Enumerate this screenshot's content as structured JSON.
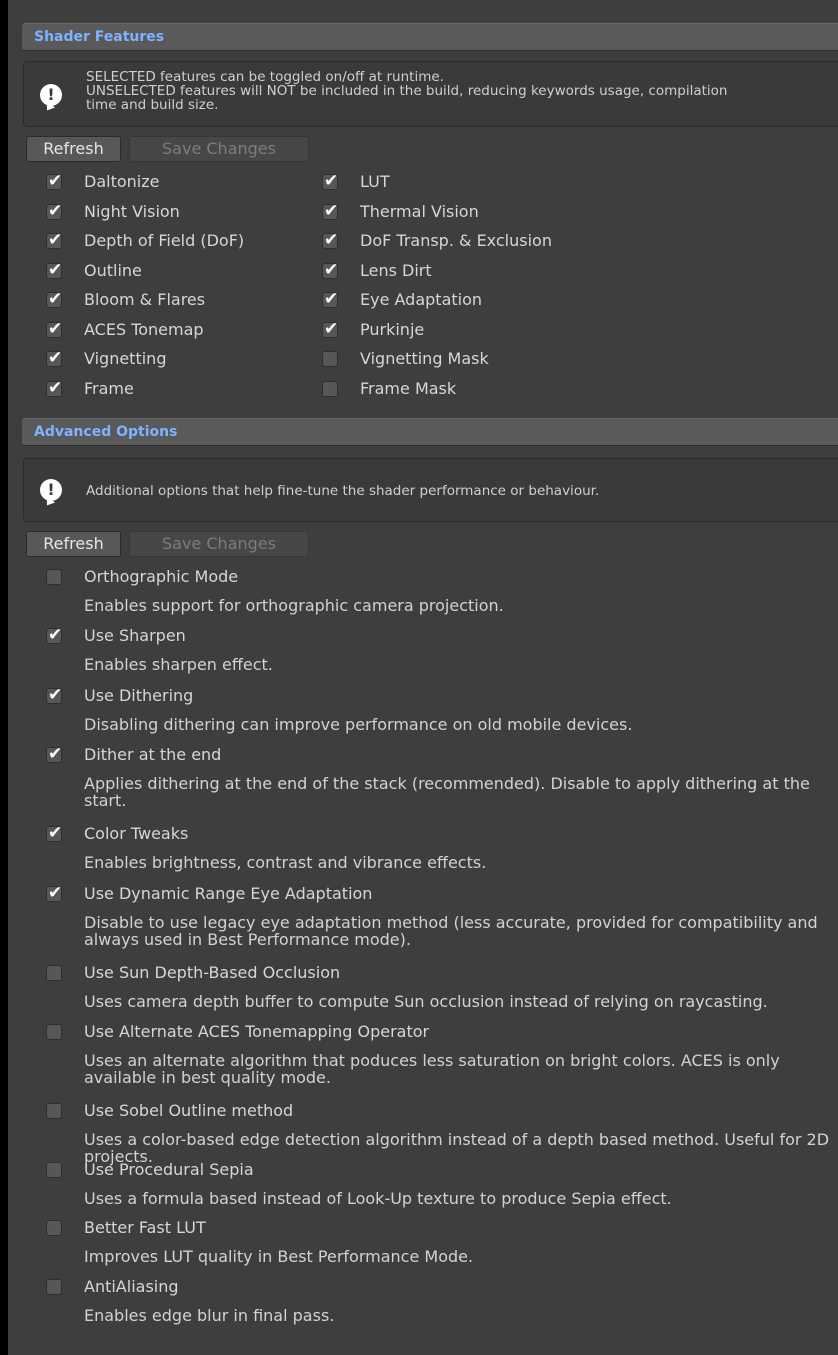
{
  "shader_features": {
    "header": "Shader Features",
    "help_text": "SELECTED features can be toggled on/off at runtime.\nUNSELECTED features will NOT be included in the build, reducing keywords usage, compilation\ntime and build size.",
    "refresh_label": "Refresh",
    "save_label": "Save Changes",
    "left_column": [
      {
        "label": "Daltonize",
        "checked": true
      },
      {
        "label": "Night Vision",
        "checked": true
      },
      {
        "label": "Depth of Field (DoF)",
        "checked": true
      },
      {
        "label": "Outline",
        "checked": true
      },
      {
        "label": "Bloom & Flares",
        "checked": true
      },
      {
        "label": "ACES Tonemap",
        "checked": true
      },
      {
        "label": "Vignetting",
        "checked": true
      },
      {
        "label": "Frame",
        "checked": true
      }
    ],
    "right_column": [
      {
        "label": "LUT",
        "checked": true
      },
      {
        "label": "Thermal Vision",
        "checked": true
      },
      {
        "label": "DoF Transp. & Exclusion",
        "checked": true
      },
      {
        "label": "Lens Dirt",
        "checked": true
      },
      {
        "label": "Eye Adaptation",
        "checked": true
      },
      {
        "label": "Purkinje",
        "checked": true
      },
      {
        "label": "Vignetting Mask",
        "checked": false
      },
      {
        "label": "Frame Mask",
        "checked": false
      }
    ]
  },
  "advanced_options": {
    "header": "Advanced Options",
    "help_text": "Additional options that help fine-tune the shader performance or behaviour.",
    "refresh_label": "Refresh",
    "save_label": "Save Changes",
    "options": [
      {
        "label": "Orthographic Mode",
        "checked": false,
        "description": "Enables support for orthographic camera projection."
      },
      {
        "label": "Use Sharpen",
        "checked": true,
        "description": "Enables sharpen effect."
      },
      {
        "label": "Use Dithering",
        "checked": true,
        "description": "Disabling dithering can improve performance on old mobile devices."
      },
      {
        "label": "Dither at the end",
        "checked": true,
        "description": "Applies dithering at the end of the stack (recommended). Disable to apply dithering at the start."
      },
      {
        "label": "Color Tweaks",
        "checked": true,
        "description": "Enables brightness, contrast and vibrance effects."
      },
      {
        "label": "Use Dynamic Range Eye Adaptation",
        "checked": true,
        "description": "Disable to use legacy eye adaptation method (less accurate, provided for compatibility and always used in Best Performance mode)."
      },
      {
        "label": "Use Sun Depth-Based Occlusion",
        "checked": false,
        "description": "Uses camera depth buffer to compute Sun occlusion instead of relying on raycasting."
      },
      {
        "label": "Use Alternate ACES Tonemapping Operator",
        "checked": false,
        "description": "Uses an alternate algorithm that poduces less saturation on bright colors. ACES is only available in best quality mode."
      },
      {
        "label": "Use Sobel Outline method",
        "checked": false,
        "description": "Uses a color-based edge detection algorithm instead of a depth based method. Useful for 2D projects."
      },
      {
        "label": "Use Procedural Sepia",
        "checked": false,
        "description": "Uses a formula based instead of Look-Up texture to produce Sepia effect."
      },
      {
        "label": "Better Fast LUT",
        "checked": false,
        "description": "Improves LUT quality in Best Performance Mode."
      },
      {
        "label": "AntiAliasing",
        "checked": false,
        "description": "Enables edge blur in final pass."
      }
    ]
  },
  "colors": {
    "panel_bg": "#3e3e3e",
    "header_text": "#7fb2ff",
    "text": "#d2d2d2"
  }
}
